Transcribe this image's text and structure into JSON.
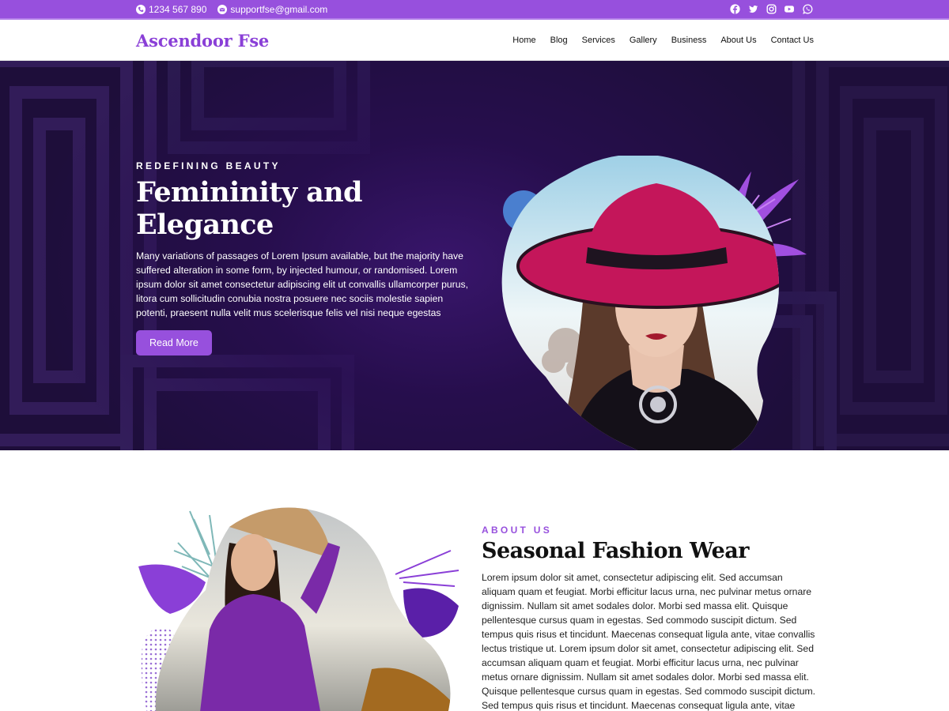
{
  "topbar": {
    "phone": "1234 567 890",
    "email": "supportfse@gmail.com",
    "socials": [
      "facebook-icon",
      "twitter-icon",
      "instagram-icon",
      "youtube-icon",
      "whatsapp-icon"
    ]
  },
  "header": {
    "logo": "Ascendoor Fse",
    "nav": [
      "Home",
      "Blog",
      "Services",
      "Gallery",
      "Business",
      "About Us",
      "Contact Us"
    ]
  },
  "hero": {
    "eyebrow": "REDEFINING BEAUTY",
    "title_line1": "Femininity and",
    "title_line2": "Elegance",
    "body": "Many variations of passages of Lorem Ipsum available, but the majority have suffered alteration in some form, by injected humour, or randomised. Lorem ipsum dolor sit amet consectetur adipiscing elit ut convallis ullamcorper purus, litora cum sollicitudin conubia nostra posuere nec sociis molestie sapien potenti, praesent nulla velit mus scelerisque felis vel nisi neque egestas",
    "button": "Read More"
  },
  "about": {
    "eyebrow": "ABOUT US",
    "title": "Seasonal Fashion Wear",
    "body": "Lorem ipsum dolor sit amet, consectetur adipiscing elit. Sed accumsan aliquam quam et feugiat. Morbi efficitur lacus urna, nec pulvinar metus ornare dignissim. Nullam sit amet sodales dolor. Morbi sed massa elit. Quisque pellentesque cursus quam in egestas. Sed commodo suscipit dictum. Sed tempus quis risus et tincidunt. Maecenas consequat ligula ante, vitae convallis lectus tristique ut. Lorem ipsum dolor sit amet, consectetur adipiscing elit. Sed accumsan aliquam quam et feugiat. Morbi efficitur lacus urna, nec pulvinar metus ornare dignissim. Nullam sit amet sodales dolor. Morbi sed massa elit. Quisque pellentesque cursus quam in egestas. Sed commodo suscipit dictum. Sed tempus quis risus et tincidunt. Maecenas consequat ligula ante, vitae convallis lectus tristique ut."
  },
  "colors": {
    "accent": "#9750dd",
    "hero_bg": "#1f0f3d",
    "hat": "#c4165a",
    "title_text": "#111111"
  }
}
